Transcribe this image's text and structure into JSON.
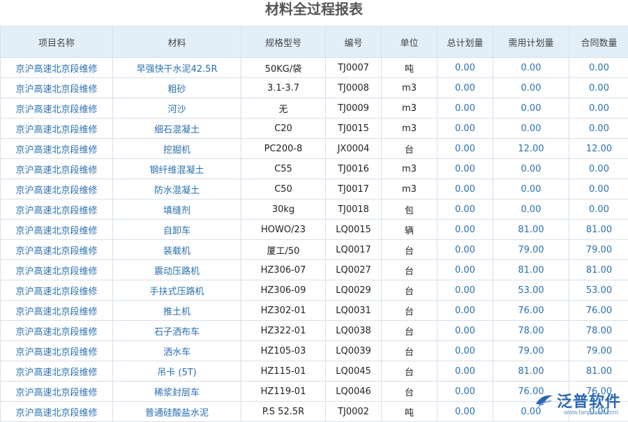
{
  "page": {
    "title": "材料全过程报表"
  },
  "table": {
    "headers": [
      "项目名称",
      "材料",
      "规格型号",
      "编号",
      "单位",
      "总计划量",
      "需用计划量",
      "合同数量"
    ],
    "rows": [
      [
        "京沪高速北京段维修",
        "早强快干水泥42.5R",
        "50KG/袋",
        "TJ0007",
        "吨",
        "0.00",
        "0.00",
        "0.00"
      ],
      [
        "京沪高速北京段维修",
        "粗砂",
        "3.1-3.7",
        "TJ0008",
        "m3",
        "0.00",
        "0.00",
        "0.00"
      ],
      [
        "京沪高速北京段维修",
        "河沙",
        "无",
        "TJ0009",
        "m3",
        "0.00",
        "0.00",
        "0.00"
      ],
      [
        "京沪高速北京段维修",
        "细石混凝土",
        "C20",
        "TJ0015",
        "m3",
        "0.00",
        "0.00",
        "0.00"
      ],
      [
        "京沪高速北京段维修",
        "挖掘机",
        "PC200-8",
        "JX0004",
        "台",
        "0.00",
        "12.00",
        "12.00"
      ],
      [
        "京沪高速北京段维修",
        "钢纤维混凝土",
        "C55",
        "TJ0016",
        "m3",
        "0.00",
        "0.00",
        "0.00"
      ],
      [
        "京沪高速北京段维修",
        "防水混凝土",
        "C50",
        "TJ0017",
        "m3",
        "0.00",
        "0.00",
        "0.00"
      ],
      [
        "京沪高速北京段维修",
        "填缝剂",
        "30kg",
        "TJ0018",
        "包",
        "0.00",
        "0.00",
        "0.00"
      ],
      [
        "京沪高速北京段维修",
        "自卸车",
        "HOWO/23",
        "LQ0015",
        "辆",
        "0.00",
        "81.00",
        "81.00"
      ],
      [
        "京沪高速北京段维修",
        "装载机",
        "厦工/50",
        "LQ0017",
        "台",
        "0.00",
        "79.00",
        "79.00"
      ],
      [
        "京沪高速北京段维修",
        "震动压路机",
        "HZ306-07",
        "LQ0027",
        "台",
        "0.00",
        "81.00",
        "81.00"
      ],
      [
        "京沪高速北京段维修",
        "手扶式压路机",
        "HZ306-09",
        "LQ0029",
        "台",
        "0.00",
        "53.00",
        "53.00"
      ],
      [
        "京沪高速北京段维修",
        "推土机",
        "HZ302-01",
        "LQ0031",
        "台",
        "0.00",
        "76.00",
        "76.00"
      ],
      [
        "京沪高速北京段维修",
        "石子洒布车",
        "HZ322-01",
        "LQ0038",
        "台",
        "0.00",
        "78.00",
        "78.00"
      ],
      [
        "京沪高速北京段维修",
        "洒水车",
        "HZ105-03",
        "LQ0039",
        "台",
        "0.00",
        "79.00",
        "79.00"
      ],
      [
        "京沪高速北京段维修",
        "吊卡 (5T)",
        "HZ115-01",
        "LQ0045",
        "台",
        "0.00",
        "81.00",
        "81.00"
      ],
      [
        "京沪高速北京段维修",
        "稀浆封层车",
        "HZ119-01",
        "LQ0046",
        "台",
        "0.00",
        "76.00",
        "76.00"
      ],
      [
        "京沪高速北京段维修",
        "普通硅酸盐水泥",
        "P.S 52.5R",
        "TJ0002",
        "吨",
        "0.00",
        "0.00",
        "0.00"
      ]
    ]
  },
  "watermark": {
    "brand": "泛普软件",
    "url": "www.fanpusoft.com",
    "icon": "fanpu-logo-icon"
  },
  "colors": {
    "header_bg": "#e2eff9",
    "link_text": "#2a6fb0",
    "grid": "#d6e0ea"
  }
}
